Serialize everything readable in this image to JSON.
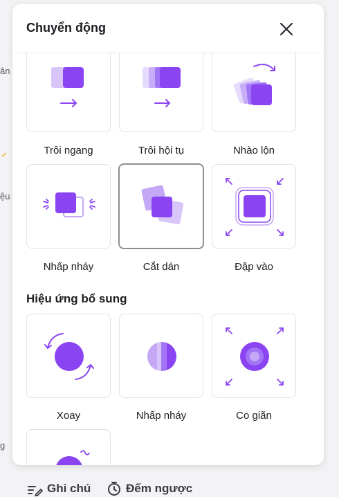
{
  "colors": {
    "accent": "#7c3aed",
    "accent_light": "#c4a7f5",
    "border": "#e2e2e8"
  },
  "left_edge": {
    "text1": "ân",
    "text2": "ệu",
    "text3": "g"
  },
  "panel": {
    "title": "Chuyển động"
  },
  "motion_effects": [
    {
      "label": "Trôi ngang",
      "icon": "drift-horizontal-icon"
    },
    {
      "label": "Trôi hội tụ",
      "icon": "converge-drift-icon"
    },
    {
      "label": "Nhào lộn",
      "icon": "tumble-icon"
    },
    {
      "label": "Nhấp nháy",
      "icon": "flicker-icon"
    },
    {
      "label": "Cắt dán",
      "icon": "collage-icon",
      "selected": true
    },
    {
      "label": "Đập vào",
      "icon": "slam-icon"
    }
  ],
  "extra_section": {
    "title": "Hiệu ứng bổ sung"
  },
  "extra_effects": [
    {
      "label": "Xoay",
      "icon": "rotate-icon"
    },
    {
      "label": "Nhấp nháy",
      "icon": "blink-icon"
    },
    {
      "label": "Co giãn",
      "icon": "scale-icon"
    },
    {
      "label": "",
      "icon": "wiggle-icon"
    }
  ],
  "toolbar": {
    "notes_label": "Ghi chú",
    "timer_label": "Đếm ngược"
  }
}
